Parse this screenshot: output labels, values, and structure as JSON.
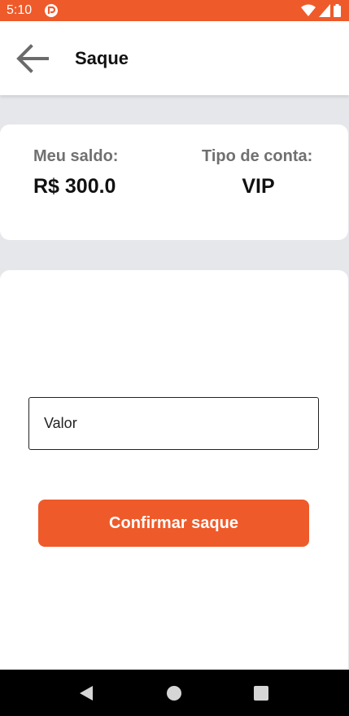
{
  "status_bar": {
    "time": "5:10",
    "background_color": "#ef5a2a",
    "app_icon": "notification-app-icon",
    "icons": [
      "wifi-icon",
      "cellular-signal-icon",
      "battery-icon"
    ]
  },
  "app_bar": {
    "title": "Saque",
    "back_icon": "arrow-left-icon"
  },
  "balance_card": {
    "balance_label": "Meu saldo:",
    "balance_value": "R$ 300.0",
    "account_type_label": "Tipo de conta:",
    "account_type_value": "VIP"
  },
  "withdraw_form": {
    "amount_placeholder": "Valor",
    "confirm_label": "Confirmar saque",
    "accent_color": "#ef5a2a"
  },
  "nav_bar": {
    "buttons": [
      "back-triangle-icon",
      "home-circle-icon",
      "recents-square-icon"
    ]
  }
}
